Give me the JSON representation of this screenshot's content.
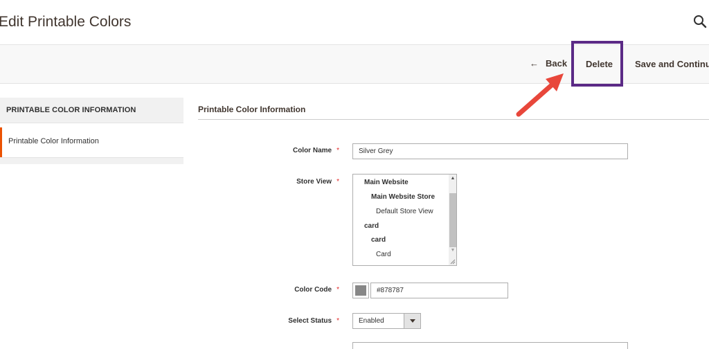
{
  "page": {
    "title": "Edit Printable Colors"
  },
  "header": {
    "search_icon": "search-icon"
  },
  "actions": {
    "back_arrow": "←",
    "back_label": "Back",
    "delete_label": "Delete",
    "save_continue_label": "Save and Continue"
  },
  "annotation": {
    "highlight_color": "#5b2a86",
    "arrow_color": "#e8473b"
  },
  "sidebar": {
    "title": "PRINTABLE COLOR INFORMATION",
    "items": [
      {
        "label": "Printable Color Information",
        "active": true
      }
    ],
    "accent": "#eb5202"
  },
  "section": {
    "title": "Printable Color Information"
  },
  "form": {
    "required_marker": "*",
    "color_name": {
      "label": "Color Name",
      "value": "Silver Grey"
    },
    "store_view": {
      "label": "Store View",
      "options": [
        "Main Website",
        "Main Website Store",
        "Default Store View",
        "card",
        "card",
        "Card"
      ]
    },
    "color_code": {
      "label": "Color Code",
      "value": "#878787",
      "swatch_color": "#878787"
    },
    "status": {
      "label": "Select Status",
      "value": "Enabled"
    }
  }
}
